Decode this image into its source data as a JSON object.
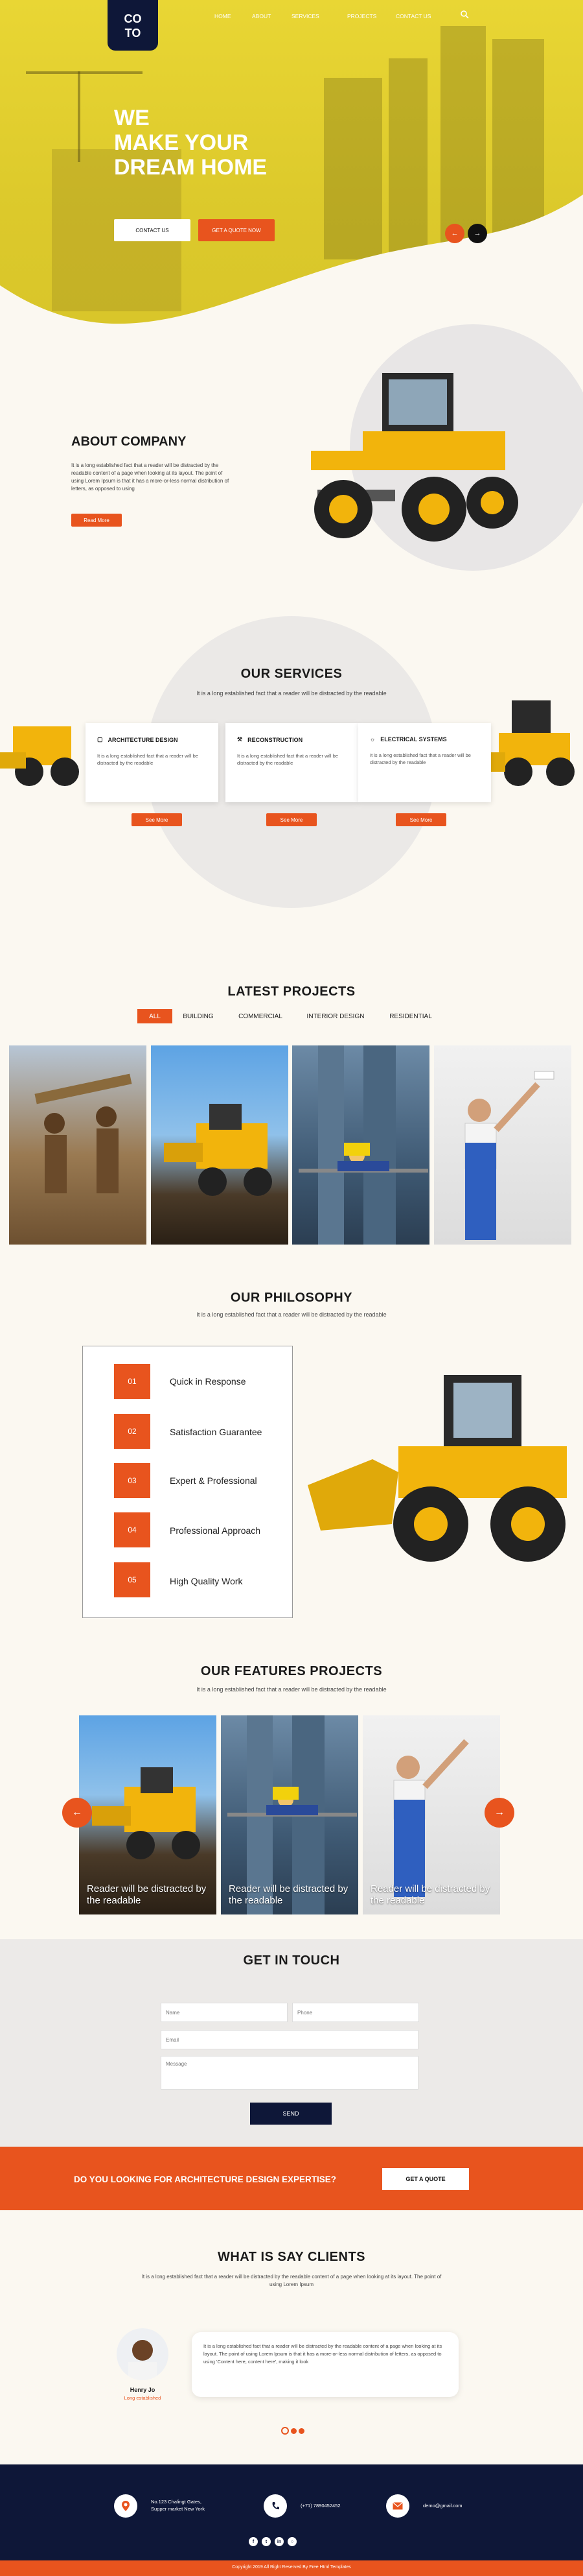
{
  "brand": {
    "logo_line1": "CO",
    "logo_line2": "TO"
  },
  "nav": {
    "items": [
      "HOME",
      "ABOUT",
      "SERVICES",
      "PROJECTS",
      "CONTACT US"
    ]
  },
  "hero": {
    "title_line1": "WE",
    "title_line2": "MAKE YOUR",
    "title_line3": "DREAM HOME",
    "btn_contact": "CONTACT US",
    "btn_quote": "GET A QUOTE NOW"
  },
  "about": {
    "title": "ABOUT COMPANY",
    "text": "It is a long established fact that a reader will be distracted by the readable content of a page when looking at its layout. The point of using Lorem Ipsum is that it has a more-or-less normal distribution of letters, as opposed to using",
    "button": "Read More"
  },
  "services": {
    "title": "OUR SERVICES",
    "subtitle": "It is a long established fact that a reader will be distracted by the readable",
    "cards": [
      {
        "title": "ARCHITECTURE DESIGN",
        "text": "It is a long established fact that a reader will be distracted by the readable",
        "button": "See More"
      },
      {
        "title": "RECONSTRUCTION",
        "text": "It is a long established fact that a reader will be distracted by the readable",
        "button": "See More"
      },
      {
        "title": "ELECTRICAL SYSTEMS",
        "text": "It is a long established fact that a reader will be distracted by the readable",
        "button": "See More"
      }
    ]
  },
  "projects": {
    "title": "LATEST PROJECTS",
    "tabs": [
      "ALL",
      "BUILDING",
      "COMMERCIAL",
      "INTERIOR DESIGN",
      "RESIDENTIAL"
    ]
  },
  "philosophy": {
    "title": "OUR PHILOSOPHY",
    "subtitle": "It is a long established fact that a reader will be distracted by the readable",
    "items": [
      {
        "num": "01",
        "label": "Quick in Response"
      },
      {
        "num": "02",
        "label": "Satisfaction Guarantee"
      },
      {
        "num": "03",
        "label": "Expert & Professional"
      },
      {
        "num": "04",
        "label": "Professional Approach"
      },
      {
        "num": "05",
        "label": "High Quality Work"
      }
    ]
  },
  "features": {
    "title": "OUR FEATURES PROJECTS",
    "subtitle": "It is a long established fact that a reader will be distracted by the readable",
    "caption": "Reader will be distracted by the readable"
  },
  "contact": {
    "title": "GET IN TOUCH",
    "name_placeholder": "Name",
    "phone_placeholder": "Phone",
    "email_placeholder": "Email",
    "message_placeholder": "Message",
    "send": "SEND"
  },
  "cta": {
    "text": "DO YOU LOOKING FOR ARCHITECTURE DESIGN EXPERTISE?",
    "button": "GET A QUOTE"
  },
  "testimonials": {
    "title": "WHAT IS SAY CLIENTS",
    "subtitle": "It is a long established fact that a reader will be distracted by the readable content of a page when looking at its layout. The point of using Lorem Ipsum",
    "quote": "It is a long established fact that a reader will be distracted by the readable content of a page when looking at its layout. The point of using Lorem Ipsum is that it has a more-or-less normal distribution of letters, as opposed to using 'Content here, content here', making it look",
    "name": "Henry Jo",
    "role": "Long established"
  },
  "footer": {
    "address_line1": "No.123 Chalingt Gates,",
    "address_line2": "Supper market New York",
    "phone": "(+71) 7890452452",
    "email": "demo@gmail.com",
    "copyright": "Copyright 2019 All Right Reserved By Free Html Templates"
  },
  "colors": {
    "accent": "#e8541e",
    "yellow": "#e3cf2f",
    "navy": "#0e1738",
    "bg": "#fbf8f1"
  }
}
